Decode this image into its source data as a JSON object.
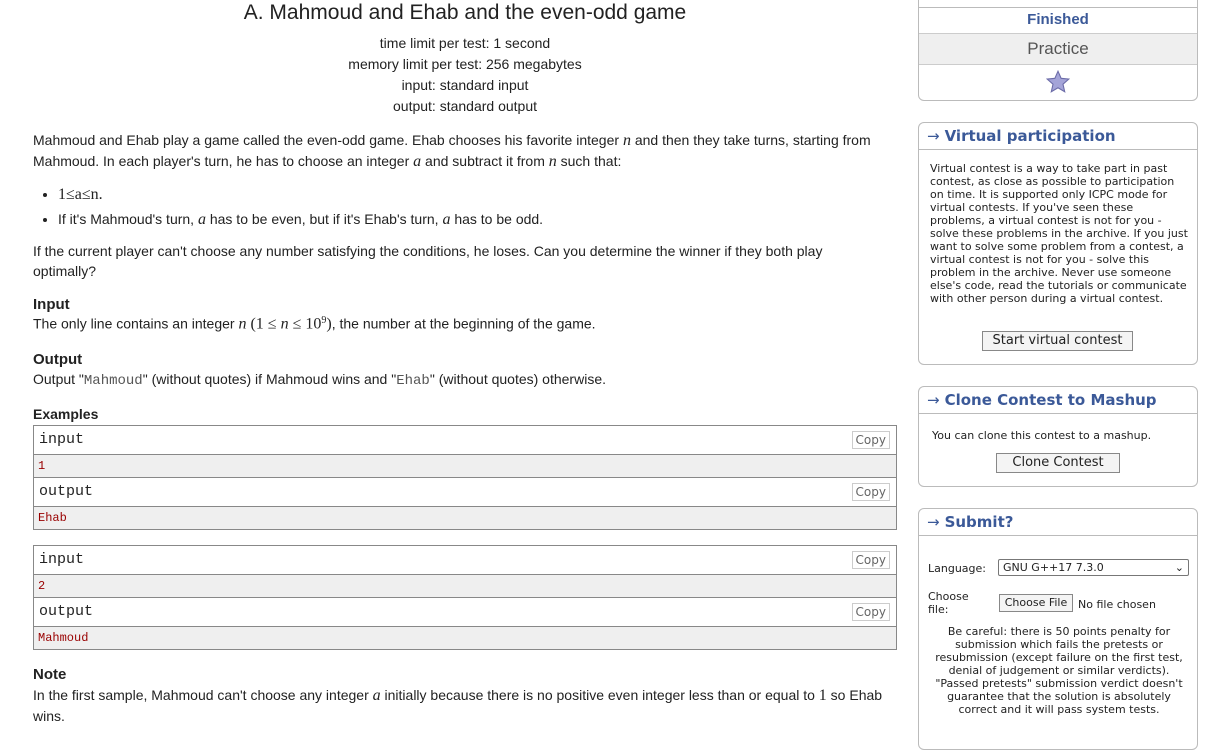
{
  "problem": {
    "title": "A. Mahmoud and Ehab and the even-odd game",
    "time_limit": "time limit per test: 1 second",
    "memory_limit": "memory limit per test: 256 megabytes",
    "input_file": "input: standard input",
    "output_file": "output: standard output"
  },
  "statement": {
    "p1_a": "Mahmoud and Ehab play a game called the even-odd game. Ehab chooses his favorite integer ",
    "p1_n": "n",
    "p1_b": " and then they take turns, starting from Mahmoud. In each player's turn, he has to choose an integer ",
    "p1_a_var": "a",
    "p1_c": " and subtract it from ",
    "p1_n2": "n",
    "p1_d": " such that:",
    "rule1": "1≤a≤n.",
    "rule2_a": "If it's Mahmoud's turn, ",
    "rule2_var1": "a",
    "rule2_b": " has to be even, but if it's Ehab's turn, ",
    "rule2_var2": "a",
    "rule2_c": " has to be odd.",
    "p2": "If the current player can't choose any number satisfying the conditions, he loses. Can you determine the winner if they both play optimally?"
  },
  "input_section": {
    "heading": "Input",
    "text_a": "The only line contains an integer ",
    "var": "n",
    "math_open": " (1 ≤ ",
    "math_var": "n",
    "math_le": " ≤ 10",
    "exp": "9",
    "math_close": ")",
    "text_b": ", the number at the beginning of the game."
  },
  "output_section": {
    "heading": "Output",
    "text_a": "Output \"",
    "code1": "Mahmoud",
    "text_b": "\" (without quotes) if Mahmoud wins and \"",
    "code2": "Ehab",
    "text_c": "\" (without quotes) otherwise."
  },
  "examples": {
    "heading": "Examples",
    "copy_label": "Copy",
    "items": [
      {
        "input_label": "input",
        "input": "1",
        "output_label": "output",
        "output": "Ehab"
      },
      {
        "input_label": "input",
        "input": "2",
        "output_label": "output",
        "output": "Mahmoud"
      }
    ]
  },
  "note": {
    "heading": "Note",
    "text_a": "In the first sample, Mahmoud can't choose any integer ",
    "var": "a",
    "text_b": " initially because there is no positive even integer less than or equal to ",
    "one": "1",
    "text_c": " so Ehab wins."
  },
  "sidebar": {
    "status": "Finished",
    "mode": "Practice",
    "virtual": {
      "title": "Virtual participation",
      "text": "Virtual contest is a way to take part in past contest, as close as possible to participation on time. It is supported only ICPC mode for virtual contests. If you've seen these problems, a virtual contest is not for you - solve these problems in the archive. If you just want to solve some problem from a contest, a virtual contest is not for you - solve this problem in the archive. Never use someone else's code, read the tutorials or communicate with other person during a virtual contest.",
      "button": "Start virtual contest"
    },
    "clone": {
      "title": "Clone Contest to Mashup",
      "text": "You can clone this contest to a mashup.",
      "button": "Clone Contest"
    },
    "submit": {
      "title": "Submit?",
      "language_label": "Language:",
      "language_value": "GNU G++17 7.3.0",
      "file_label": "Choose file:",
      "file_button": "Choose File",
      "file_status": "No file chosen",
      "warning": "Be careful: there is 50 points penalty for submission which fails the pretests or resubmission (except failure on the first test, denial of judgement or similar verdicts). \"Passed pretests\" submission verdict doesn't guarantee that the solution is absolutely correct and it will pass system tests."
    },
    "arrow": "→",
    "colors": {
      "link": "#3b5998",
      "star": "#8e8ec8"
    },
    "star_icon": "star-icon"
  }
}
